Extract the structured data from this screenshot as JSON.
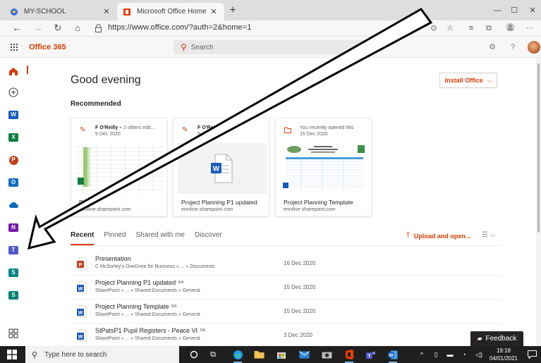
{
  "browser": {
    "tabs": [
      {
        "title": "MY-SCHOOL",
        "active": false,
        "favicon": "school-icon"
      },
      {
        "title": "Microsoft Office Home",
        "active": true,
        "favicon": "office-icon"
      }
    ],
    "new_tab": "+",
    "window_controls": {
      "minimize": "—",
      "maximize": "☐",
      "close": "✕"
    },
    "url": "https://www.office.com/?auth=2&home=1"
  },
  "office": {
    "brand": "Office 365",
    "search_placeholder": "Search",
    "help": "?",
    "greeting": "Good evening",
    "install_label": "Install Office",
    "recommended_title": "Recommended",
    "recommended": [
      {
        "actor": "F O'Reilly",
        "action": " + 2 others edit...",
        "date": "9 Dec 2020",
        "name": "P1",
        "location": "ennilive.sharepoint.com",
        "activity_icon": "edit-icon",
        "thumb": "spreadsheet"
      },
      {
        "actor": "F O'Re",
        "action": "...",
        "date": "9",
        "name": "Project Planning P1 updated",
        "location": "ennilive.sharepoint.com",
        "activity_icon": "edit-icon",
        "thumb": "word"
      },
      {
        "actor": "",
        "action": "You recently opened this",
        "date": "15 Dec 2020",
        "name": "Project Planning Template",
        "location": "ennilive.sharepoint.com",
        "activity_icon": "folder-open-icon",
        "thumb": "template"
      }
    ],
    "file_tabs": [
      "Recent",
      "Pinned",
      "Shared with me",
      "Discover"
    ],
    "upload_label": "Upload and open...",
    "files": [
      {
        "name": "Presentation",
        "path": "C McSorley's OneDrive for Business » ... » Documents",
        "date": "16 Dec 2020",
        "type": "powerpoint",
        "shared": false
      },
      {
        "name": "Project Planning P1 updated",
        "path": "SharePoint » ... » Shared Documents » General",
        "date": "15 Dec 2020",
        "type": "word",
        "shared": true
      },
      {
        "name": "Project Planning Template",
        "path": "SharePoint » ... » Shared Documents » General",
        "date": "15 Dec 2020",
        "type": "word",
        "shared": true
      },
      {
        "name": "StPatsP1 Pupil Registers - Peace VI",
        "path": "SharePoint » ... » Shared Documents » General",
        "date": "3 Dec 2020",
        "type": "word",
        "shared": true
      }
    ],
    "share_glyph": "ᴿᴬ",
    "feedback_label": "Feedback"
  },
  "rail": [
    {
      "name": "home",
      "color": "#d83b01",
      "letter": ""
    },
    {
      "name": "create",
      "color": "#444444",
      "letter": ""
    },
    {
      "name": "word",
      "color": "#185abd",
      "letter": "W"
    },
    {
      "name": "excel",
      "color": "#107c41",
      "letter": "X"
    },
    {
      "name": "powerpoint",
      "color": "#c43e1c",
      "letter": "P"
    },
    {
      "name": "outlook",
      "color": "#0f6cbd",
      "letter": "O"
    },
    {
      "name": "onedrive",
      "color": "#0f6cbd",
      "letter": ""
    },
    {
      "name": "onenote",
      "color": "#7719aa",
      "letter": "N"
    },
    {
      "name": "teams",
      "color": "#5059c9",
      "letter": "T"
    },
    {
      "name": "sharepoint",
      "color": "#038387",
      "letter": "S"
    },
    {
      "name": "sway",
      "color": "#008272",
      "letter": "S"
    },
    {
      "name": "all-apps",
      "color": "#444444",
      "letter": ""
    }
  ],
  "taskbar": {
    "search_placeholder": "Type here to search",
    "time": "19:18",
    "date": "04/01/2021"
  },
  "colors": {
    "accent": "#d83b01",
    "word": "#185abd",
    "powerpoint": "#c43e1c"
  }
}
